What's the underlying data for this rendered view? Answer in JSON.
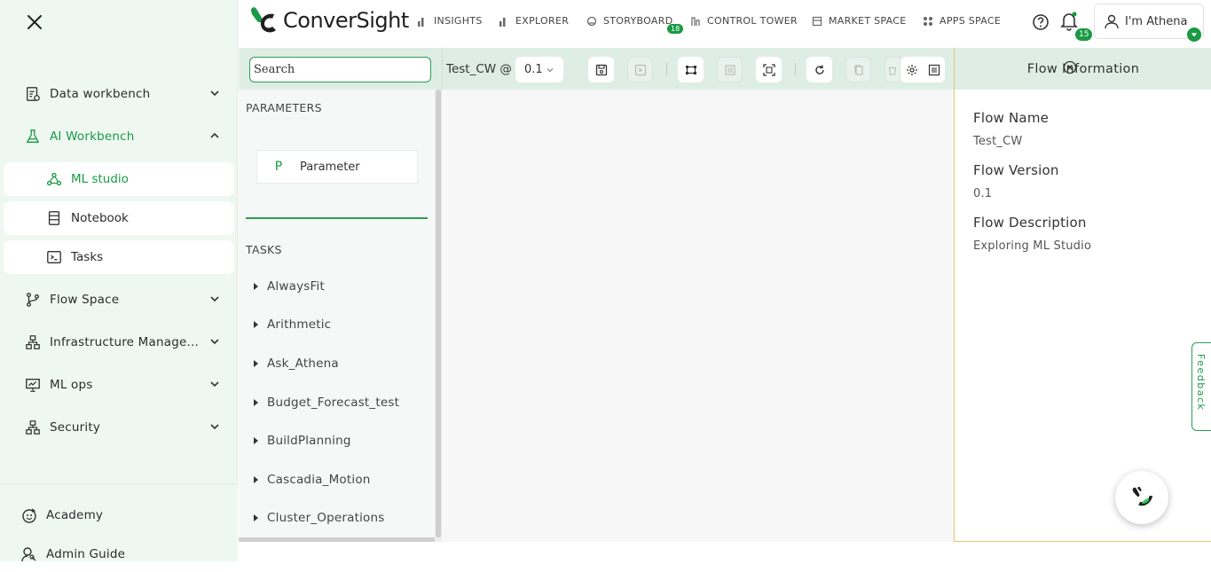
{
  "sidebar": {
    "items": [
      {
        "label": "Data workbench",
        "icon": "report-icon"
      },
      {
        "label": "AI Workbench",
        "icon": "flask-icon"
      },
      {
        "label": "Flow Space",
        "icon": "branch-icon"
      },
      {
        "label": "Infrastructure Manage...",
        "icon": "hierarchy-icon"
      },
      {
        "label": "ML ops",
        "icon": "presentation-chart-icon"
      },
      {
        "label": "Security",
        "icon": "hierarchy-icon"
      }
    ],
    "sub_items": [
      {
        "label": "ML studio",
        "icon": "nodes-icon"
      },
      {
        "label": "Notebook",
        "icon": "notebook-icon"
      },
      {
        "label": "Tasks",
        "icon": "terminal-icon"
      }
    ],
    "bottom": [
      {
        "label": "Academy",
        "icon": "academy-icon"
      },
      {
        "label": "Admin Guide",
        "icon": "user-search-icon"
      }
    ]
  },
  "topbar": {
    "brand": "ConverSight",
    "nav": [
      {
        "label": "INSIGHTS"
      },
      {
        "label": "EXPLORER"
      },
      {
        "label": "STORYBOARD",
        "badge": "18"
      },
      {
        "label": "CONTROL TOWER"
      },
      {
        "label": "MARKET SPACE"
      },
      {
        "label": "APPS SPACE"
      }
    ],
    "notifications": "15",
    "user": "I'm Athena"
  },
  "toolbar": {
    "search_placeholder": "Search",
    "flow_title": "Test_CW @",
    "version": "0.1"
  },
  "left_panel": {
    "parameters_heading": "PARAMETERS",
    "parameter_letter": "P",
    "parameter_label": "Parameter",
    "tasks_heading": "TASKS",
    "tasks": [
      "AlwaysFit",
      "Arithmetic",
      "Ask_Athena",
      "Budget_Forecast_test",
      "BuildPlanning",
      "Cascadia_Motion",
      "Cluster_Operations"
    ]
  },
  "right_panel": {
    "title": "Flow Information",
    "flow_name_label": "Flow Name",
    "flow_name": "Test_CW",
    "flow_version_label": "Flow Version",
    "flow_version": "0.1",
    "flow_description_label": "Flow Description",
    "flow_description": "Exploring ML Studio"
  },
  "feedback_label": "Feedback",
  "colors": {
    "accent": "#1a9a45",
    "toolbar_bg": "#dfeee5",
    "sidebar_bg": "#eef8f1"
  }
}
